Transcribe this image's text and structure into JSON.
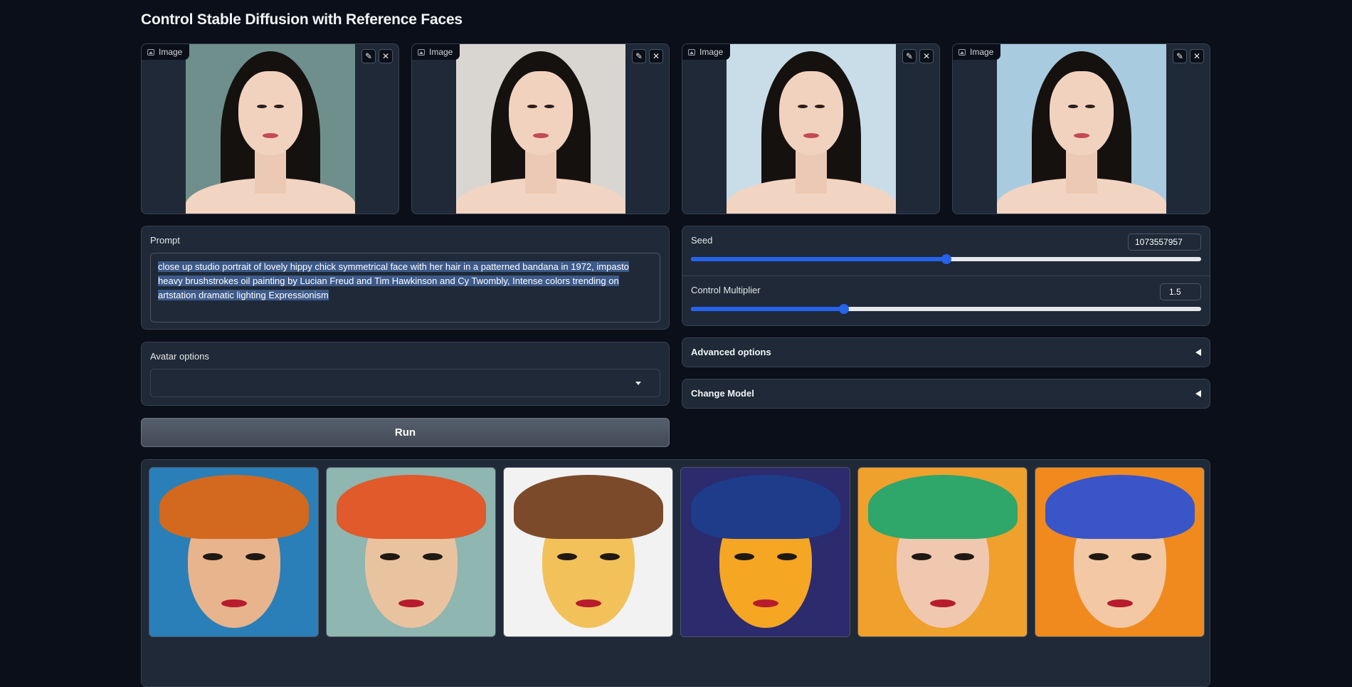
{
  "app": {
    "title": "Control Stable Diffusion with Reference Faces"
  },
  "reference_images": [
    {
      "label": "Image",
      "edit_icon": "pencil-icon",
      "clear_icon": "close-icon",
      "bg": "#6f8f8c"
    },
    {
      "label": "Image",
      "edit_icon": "pencil-icon",
      "clear_icon": "close-icon",
      "bg": "#d9d6d2"
    },
    {
      "label": "Image",
      "edit_icon": "pencil-icon",
      "clear_icon": "close-icon",
      "bg": "#c9dde8"
    },
    {
      "label": "Image",
      "edit_icon": "pencil-icon",
      "clear_icon": "close-icon",
      "bg": "#a9cbe0"
    }
  ],
  "prompt": {
    "label": "Prompt",
    "value": "close up studio portrait of lovely hippy chick symmetrical face with her hair in a patterned bandana in 1972, impasto heavy brushstrokes oil painting by Lucian Freud and Tim Hawkinson and Cy Twombly, Intense colors trending on artstation dramatic lighting Expressionism"
  },
  "seed": {
    "label": "Seed",
    "value": "1073557957",
    "fraction": 0.5
  },
  "control_multiplier": {
    "label": "Control Multiplier",
    "value": "1.5",
    "fraction": 0.3
  },
  "avatar_options": {
    "label": "Avatar options",
    "value": ""
  },
  "advanced_options": {
    "label": "Advanced options"
  },
  "change_model": {
    "label": "Change Model"
  },
  "run": {
    "label": "Run"
  },
  "gallery": [
    {
      "bg": "#2a7fb8",
      "skin": "#e8b48e",
      "wrap": "#d2691e"
    },
    {
      "bg": "#8fb6b0",
      "skin": "#e9c3a0",
      "wrap": "#e05a2b"
    },
    {
      "bg": "#f2f2f2",
      "skin": "#f2c15a",
      "wrap": "#7b4a2a"
    },
    {
      "bg": "#2b2b6e",
      "skin": "#f5a623",
      "wrap": "#1e3c8a"
    },
    {
      "bg": "#f0a02c",
      "skin": "#f0c8b0",
      "wrap": "#2fa66a"
    },
    {
      "bg": "#f08a1e",
      "skin": "#f2c9a4",
      "wrap": "#3a55c8"
    }
  ],
  "colors": {
    "accent": "#2563eb",
    "panel": "#1f2937",
    "background": "#0b0f19"
  }
}
